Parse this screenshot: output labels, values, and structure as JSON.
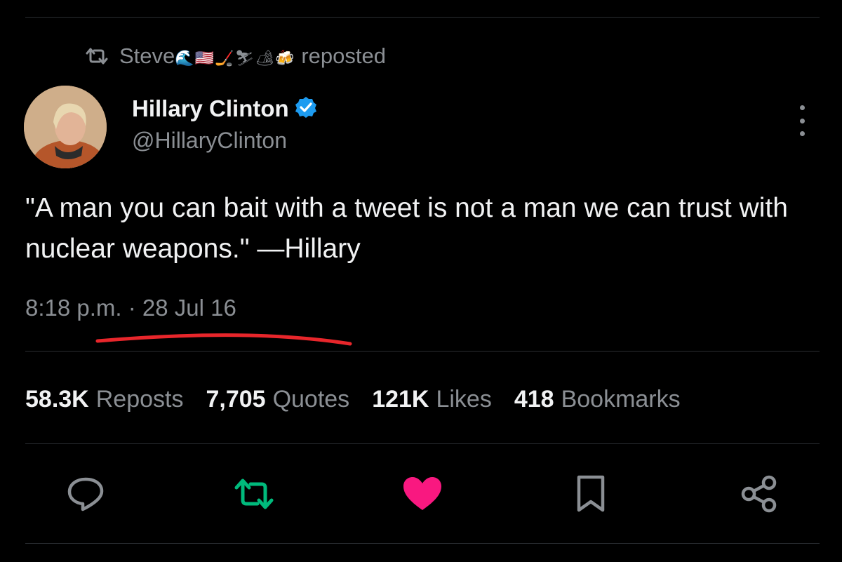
{
  "repost_banner": {
    "user": "Steve",
    "emojis": "🌊🇺🇸🏒⛷🏕🍻",
    "suffix": "reposted"
  },
  "author": {
    "name": "Hillary Clinton",
    "handle": "@HillaryClinton",
    "verified": true
  },
  "tweet": {
    "text": "\"A man you can bait with a tweet is not a man we can trust with nuclear weapons.\" —Hillary",
    "timestamp": "8:18 p.m. · 28 Jul 16"
  },
  "stats": [
    {
      "count": "58.3K",
      "label": "Reposts"
    },
    {
      "count": "7,705",
      "label": "Quotes"
    },
    {
      "count": "121K",
      "label": "Likes"
    },
    {
      "count": "418",
      "label": "Bookmarks"
    }
  ],
  "actions": {
    "reply": "reply-icon",
    "repost": "repost-icon",
    "like": "heart-icon",
    "bookmark": "bookmark-icon",
    "share": "share-icon"
  },
  "colors": {
    "background": "#000000",
    "muted": "#8b8f94",
    "verified": "#1d9bf0",
    "repost_active": "#00ba7c",
    "like_active": "#f91880",
    "annotation": "#e8262b"
  }
}
